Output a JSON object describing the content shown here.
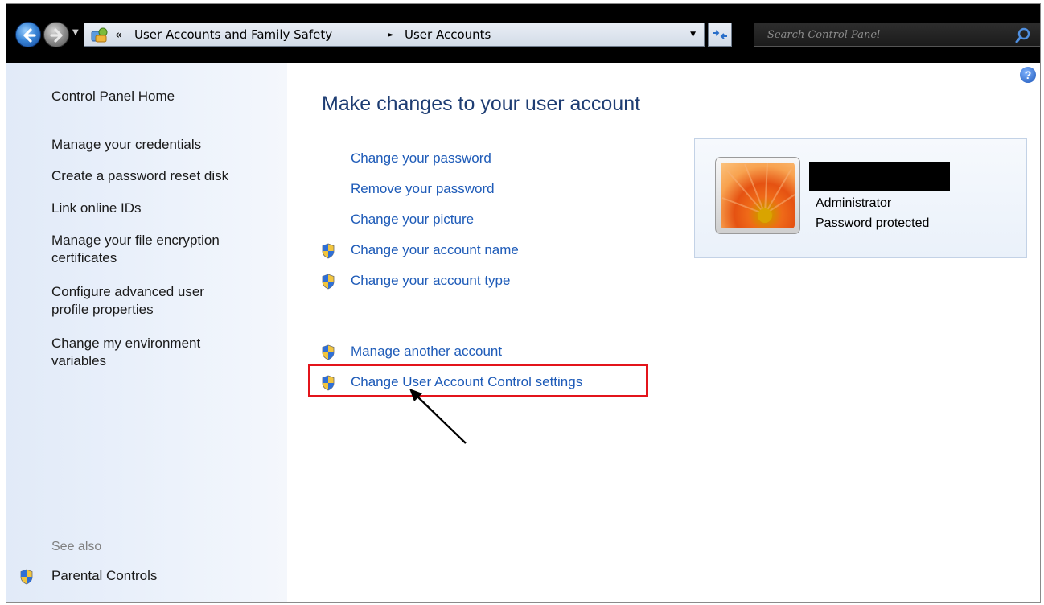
{
  "address_bar": {
    "overflow_glyph": "«",
    "crumbs": [
      "User Accounts and Family Safety",
      "User Accounts"
    ],
    "separator": "►",
    "search_placeholder": "Search Control Panel"
  },
  "left_pane": {
    "home_link": "Control Panel Home",
    "links": [
      "Manage your credentials",
      "Create a password reset disk",
      "Link online IDs",
      "Manage your file encryption certificates",
      "Configure advanced user profile properties",
      "Change my environment variables"
    ],
    "see_also_label": "See also",
    "see_also_links": [
      "Parental Controls"
    ]
  },
  "main": {
    "heading": "Make changes to your user account",
    "tasks": [
      {
        "label": "Change your password",
        "shield": false
      },
      {
        "label": "Remove your password",
        "shield": false
      },
      {
        "label": "Change your picture",
        "shield": false
      },
      {
        "label": "Change your account name",
        "shield": true
      },
      {
        "label": "Change your account type",
        "shield": true
      }
    ],
    "other_tasks": [
      {
        "label": "Manage another account",
        "shield": true
      },
      {
        "label": "Change User Account Control settings",
        "shield": true
      }
    ],
    "highlighted_task": "Change User Account Control settings"
  },
  "account": {
    "role": "Administrator",
    "status": "Password protected"
  },
  "help_glyph": "?",
  "colors": {
    "link": "#1e5bb8",
    "heading": "#1e3d73",
    "highlight": "#e3141b",
    "left_pane_bg": "#e1eaf8"
  },
  "icons": [
    "back-arrow-icon",
    "forward-arrow-icon",
    "control-panel-icon",
    "refresh-icon",
    "search-icon",
    "help-icon",
    "uac-shield-icon"
  ]
}
